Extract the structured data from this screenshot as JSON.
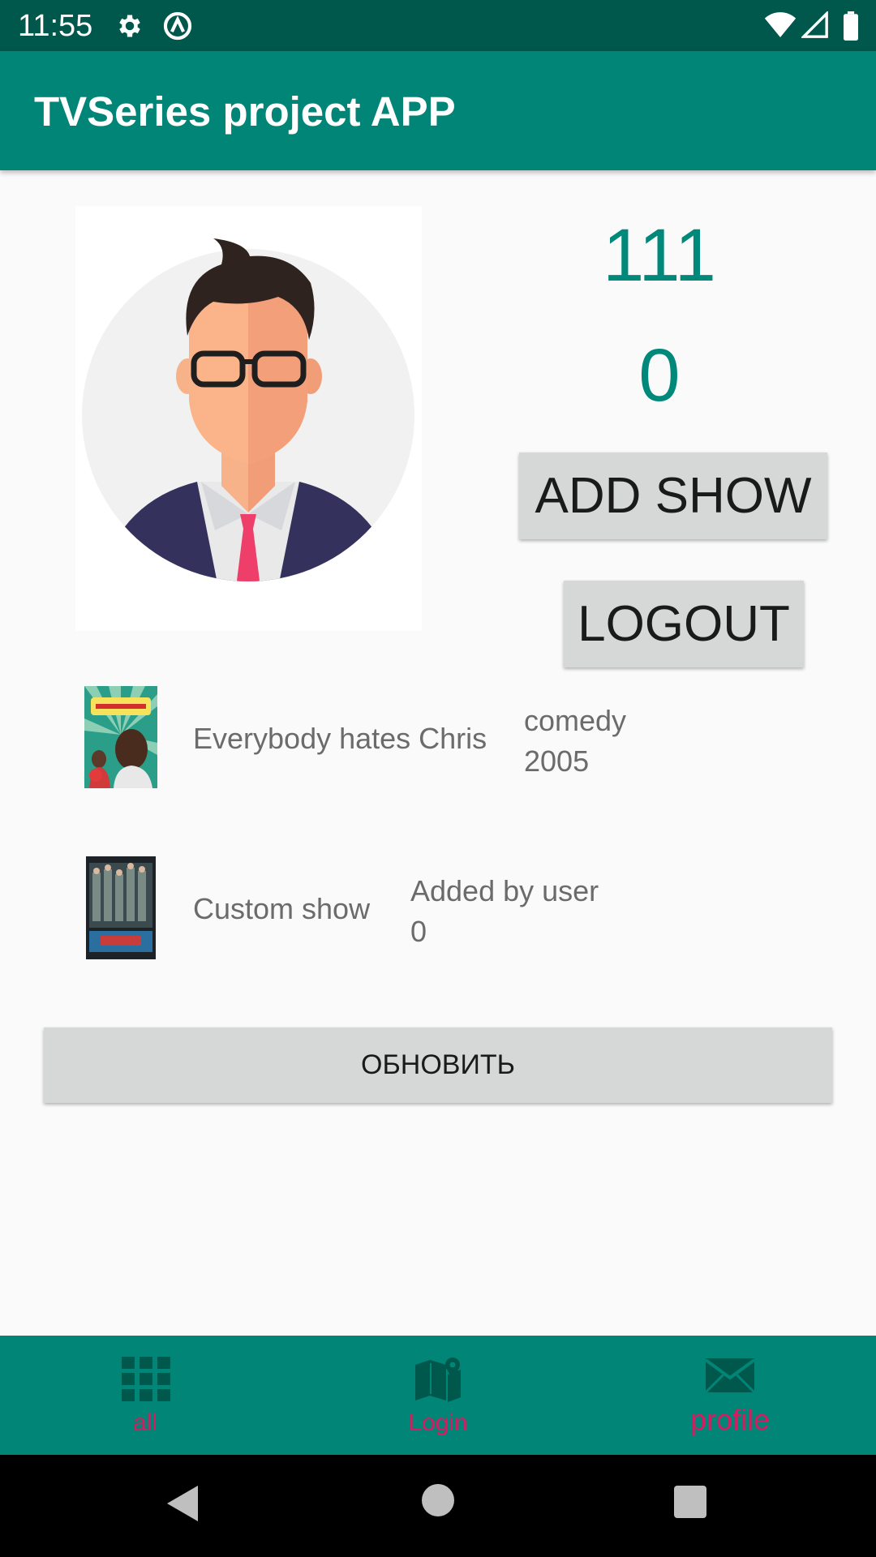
{
  "status_bar": {
    "time": "11:55",
    "icons": [
      "gear-icon",
      "circle-a-icon",
      "wifi-icon",
      "signal-icon",
      "battery-icon"
    ]
  },
  "app_bar": {
    "title": "TVSeries project APP"
  },
  "profile": {
    "avatar_icon": "user-avatar-icon",
    "stat_first": "111",
    "stat_second": "0",
    "add_show_label": "ADD SHOW",
    "logout_label": "LOGOUT"
  },
  "shows": [
    {
      "title": "Everybody hates Chris",
      "genre": "comedy",
      "year": "2005",
      "poster_icon": "show-poster-icon"
    },
    {
      "title": "Custom show",
      "genre": "Added by user",
      "year": "0",
      "poster_icon": "show-poster-icon"
    }
  ],
  "refresh_label": "ОБНОВИТЬ",
  "bottom_nav": {
    "items": [
      {
        "label": "all",
        "icon": "grid-icon"
      },
      {
        "label": "Login",
        "icon": "map-icon"
      },
      {
        "label": "profile",
        "icon": "mail-icon"
      }
    ]
  },
  "system_nav": {
    "icons": [
      "back-icon",
      "home-icon",
      "recents-icon"
    ]
  },
  "colors": {
    "status_bar": "#00574b",
    "primary": "#008577",
    "accent": "#d81b60",
    "stat_text": "#00897b",
    "button_bg": "#d6d7d7",
    "nav_icon": "#00574b"
  }
}
